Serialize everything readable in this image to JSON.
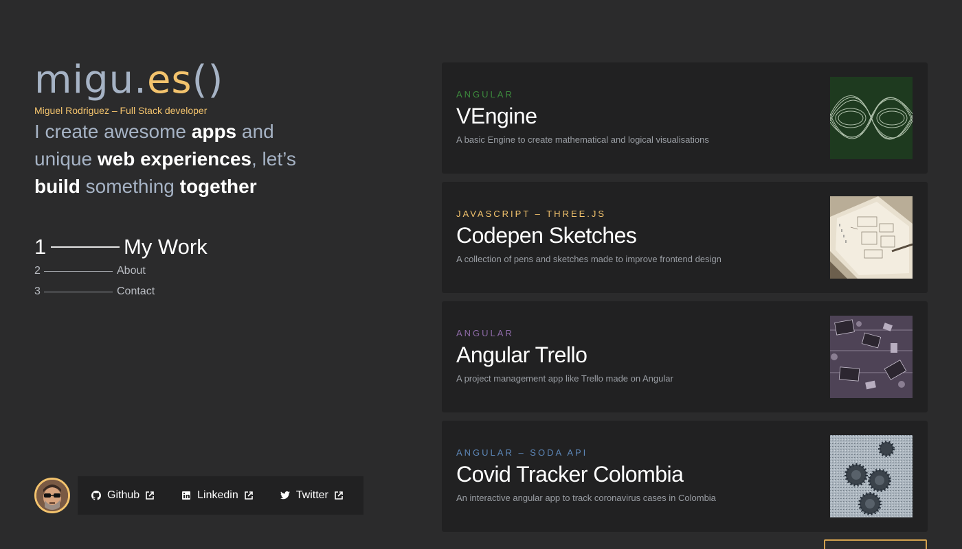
{
  "header": {
    "logo_part1": "migu.",
    "logo_part2": "es",
    "logo_part3": "()",
    "subtitle": "Miguel Rodriguez – Full Stack developer"
  },
  "tagline": {
    "t1": "I create awesome ",
    "t2": "apps",
    "t3": " and unique ",
    "t4": "web experiences",
    "t5": ", let’s ",
    "t6": "build",
    "t7": " something ",
    "t8": "together"
  },
  "nav": [
    {
      "num": "1",
      "label": "My Work",
      "active": true
    },
    {
      "num": "2",
      "label": "About"
    },
    {
      "num": "3",
      "label": "Contact"
    }
  ],
  "socials": [
    {
      "label": "Github",
      "icon": "github-icon"
    },
    {
      "label": "Linkedin",
      "icon": "linkedin-icon"
    },
    {
      "label": "Twitter",
      "icon": "twitter-icon"
    }
  ],
  "projects": [
    {
      "tech": "Angular",
      "title": "VEngine",
      "desc": "A basic Engine to create mathematical and logical visualisations",
      "color": "#3d8a3d"
    },
    {
      "tech": "Javascript – Three.js",
      "title": "Codepen Sketches",
      "desc": "A collection of pens and sketches made to improve frontend design",
      "color": "#f3c36d"
    },
    {
      "tech": "Angular",
      "title": "Angular Trello",
      "desc": "A project management app like Trello made on Angular",
      "color": "#8e6ba8"
    },
    {
      "tech": "Angular – Soda API",
      "title": "Covid Tracker Colombia",
      "desc": "An interactive angular app to track coronavirus cases in Colombia",
      "color": "#5d87b8"
    }
  ]
}
